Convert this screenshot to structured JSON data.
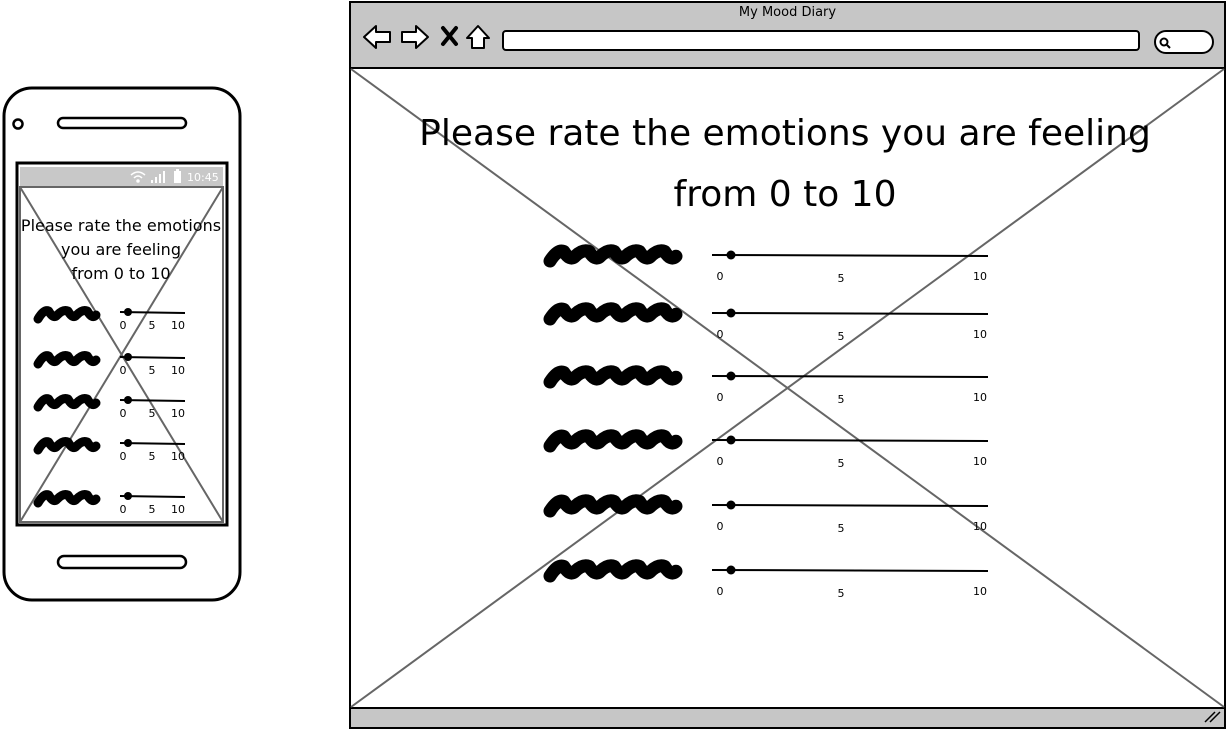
{
  "browser": {
    "title": "My Mood Diary",
    "address_bar_value": "",
    "search_field_value": ""
  },
  "phone": {
    "status_time": "10:45"
  },
  "heading": {
    "line1": "Please rate the emotions you are feeling",
    "line2": "from 0 to 10",
    "phone_line1": "Please rate the emotions",
    "phone_line2": "you are feeling",
    "phone_line3": "from 0 to 10"
  },
  "scale": {
    "min": "0",
    "mid": "5",
    "max": "10"
  },
  "emotion_ratings": [
    0,
    0,
    0,
    0,
    0,
    0
  ],
  "phone_emotion_ratings": [
    0,
    0,
    0,
    0,
    0
  ],
  "icons": [
    "back-arrow-icon",
    "forward-arrow-icon",
    "close-icon",
    "home-icon",
    "search-icon",
    "wifi-icon",
    "signal-icon",
    "battery-icon",
    "resize-grip-icon"
  ],
  "colors": {
    "frame": "#000000",
    "chrome_gray": "#c6c6c6",
    "placeholder_cross": "#666666",
    "status_bar": "#c8c8c8",
    "background": "#ffffff"
  }
}
